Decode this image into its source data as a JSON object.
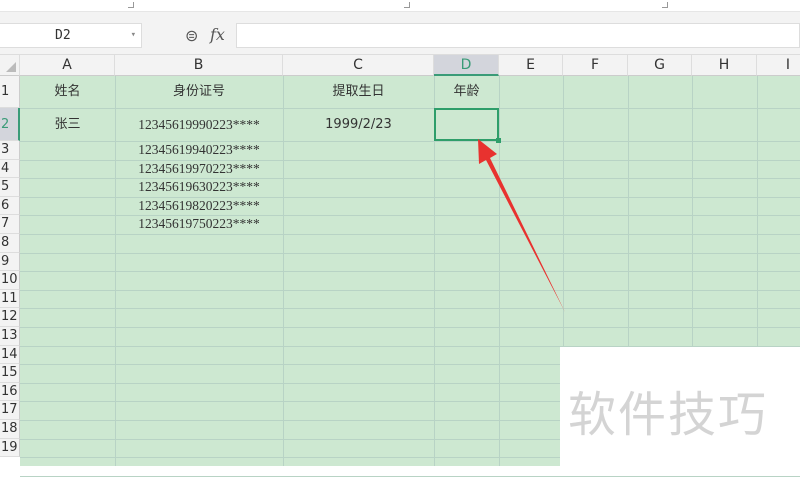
{
  "name_box": {
    "value": "D2"
  },
  "formula_bar": {
    "fx_label": "fx",
    "value": ""
  },
  "columns": [
    "A",
    "B",
    "C",
    "D",
    "E",
    "F",
    "G",
    "H",
    "I"
  ],
  "selected_column": "D",
  "rows": [
    "1",
    "2",
    "3",
    "4",
    "5",
    "6",
    "7",
    "8",
    "9",
    "10",
    "11",
    "12",
    "13",
    "14",
    "15",
    "16",
    "17",
    "18",
    "19"
  ],
  "selected_row": "2",
  "cells": {
    "A1": "姓名",
    "B1": "身份证号",
    "C1": "提取生日",
    "D1": "年龄",
    "A2": "张三",
    "B2": "12345619990223****",
    "C2": "1999/2/23",
    "B3": "12345619940223****",
    "B4": "12345619970223****",
    "B5": "12345619630223****",
    "B6": "12345619820223****",
    "B7": "12345619750223****"
  },
  "watermark": "软件技巧",
  "colors": {
    "sheet_fill": "#cde8d1",
    "selection": "#2e9e6a",
    "arrow": "#e8322f"
  }
}
